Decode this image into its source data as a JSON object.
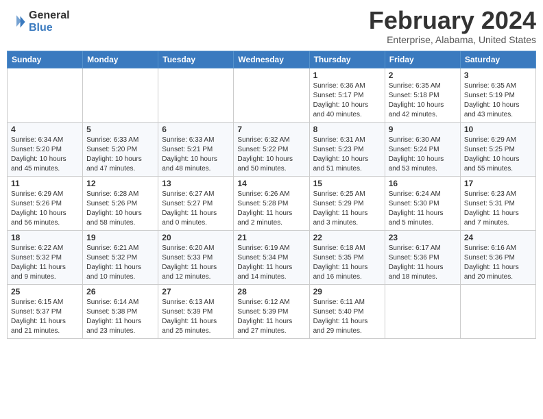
{
  "header": {
    "logo_general": "General",
    "logo_blue": "Blue",
    "month": "February 2024",
    "location": "Enterprise, Alabama, United States"
  },
  "weekdays": [
    "Sunday",
    "Monday",
    "Tuesday",
    "Wednesday",
    "Thursday",
    "Friday",
    "Saturday"
  ],
  "weeks": [
    [
      {
        "day": "",
        "info": ""
      },
      {
        "day": "",
        "info": ""
      },
      {
        "day": "",
        "info": ""
      },
      {
        "day": "",
        "info": ""
      },
      {
        "day": "1",
        "info": "Sunrise: 6:36 AM\nSunset: 5:17 PM\nDaylight: 10 hours\nand 40 minutes."
      },
      {
        "day": "2",
        "info": "Sunrise: 6:35 AM\nSunset: 5:18 PM\nDaylight: 10 hours\nand 42 minutes."
      },
      {
        "day": "3",
        "info": "Sunrise: 6:35 AM\nSunset: 5:19 PM\nDaylight: 10 hours\nand 43 minutes."
      }
    ],
    [
      {
        "day": "4",
        "info": "Sunrise: 6:34 AM\nSunset: 5:20 PM\nDaylight: 10 hours\nand 45 minutes."
      },
      {
        "day": "5",
        "info": "Sunrise: 6:33 AM\nSunset: 5:20 PM\nDaylight: 10 hours\nand 47 minutes."
      },
      {
        "day": "6",
        "info": "Sunrise: 6:33 AM\nSunset: 5:21 PM\nDaylight: 10 hours\nand 48 minutes."
      },
      {
        "day": "7",
        "info": "Sunrise: 6:32 AM\nSunset: 5:22 PM\nDaylight: 10 hours\nand 50 minutes."
      },
      {
        "day": "8",
        "info": "Sunrise: 6:31 AM\nSunset: 5:23 PM\nDaylight: 10 hours\nand 51 minutes."
      },
      {
        "day": "9",
        "info": "Sunrise: 6:30 AM\nSunset: 5:24 PM\nDaylight: 10 hours\nand 53 minutes."
      },
      {
        "day": "10",
        "info": "Sunrise: 6:29 AM\nSunset: 5:25 PM\nDaylight: 10 hours\nand 55 minutes."
      }
    ],
    [
      {
        "day": "11",
        "info": "Sunrise: 6:29 AM\nSunset: 5:26 PM\nDaylight: 10 hours\nand 56 minutes."
      },
      {
        "day": "12",
        "info": "Sunrise: 6:28 AM\nSunset: 5:26 PM\nDaylight: 10 hours\nand 58 minutes."
      },
      {
        "day": "13",
        "info": "Sunrise: 6:27 AM\nSunset: 5:27 PM\nDaylight: 11 hours\nand 0 minutes."
      },
      {
        "day": "14",
        "info": "Sunrise: 6:26 AM\nSunset: 5:28 PM\nDaylight: 11 hours\nand 2 minutes."
      },
      {
        "day": "15",
        "info": "Sunrise: 6:25 AM\nSunset: 5:29 PM\nDaylight: 11 hours\nand 3 minutes."
      },
      {
        "day": "16",
        "info": "Sunrise: 6:24 AM\nSunset: 5:30 PM\nDaylight: 11 hours\nand 5 minutes."
      },
      {
        "day": "17",
        "info": "Sunrise: 6:23 AM\nSunset: 5:31 PM\nDaylight: 11 hours\nand 7 minutes."
      }
    ],
    [
      {
        "day": "18",
        "info": "Sunrise: 6:22 AM\nSunset: 5:32 PM\nDaylight: 11 hours\nand 9 minutes."
      },
      {
        "day": "19",
        "info": "Sunrise: 6:21 AM\nSunset: 5:32 PM\nDaylight: 11 hours\nand 10 minutes."
      },
      {
        "day": "20",
        "info": "Sunrise: 6:20 AM\nSunset: 5:33 PM\nDaylight: 11 hours\nand 12 minutes."
      },
      {
        "day": "21",
        "info": "Sunrise: 6:19 AM\nSunset: 5:34 PM\nDaylight: 11 hours\nand 14 minutes."
      },
      {
        "day": "22",
        "info": "Sunrise: 6:18 AM\nSunset: 5:35 PM\nDaylight: 11 hours\nand 16 minutes."
      },
      {
        "day": "23",
        "info": "Sunrise: 6:17 AM\nSunset: 5:36 PM\nDaylight: 11 hours\nand 18 minutes."
      },
      {
        "day": "24",
        "info": "Sunrise: 6:16 AM\nSunset: 5:36 PM\nDaylight: 11 hours\nand 20 minutes."
      }
    ],
    [
      {
        "day": "25",
        "info": "Sunrise: 6:15 AM\nSunset: 5:37 PM\nDaylight: 11 hours\nand 21 minutes."
      },
      {
        "day": "26",
        "info": "Sunrise: 6:14 AM\nSunset: 5:38 PM\nDaylight: 11 hours\nand 23 minutes."
      },
      {
        "day": "27",
        "info": "Sunrise: 6:13 AM\nSunset: 5:39 PM\nDaylight: 11 hours\nand 25 minutes."
      },
      {
        "day": "28",
        "info": "Sunrise: 6:12 AM\nSunset: 5:39 PM\nDaylight: 11 hours\nand 27 minutes."
      },
      {
        "day": "29",
        "info": "Sunrise: 6:11 AM\nSunset: 5:40 PM\nDaylight: 11 hours\nand 29 minutes."
      },
      {
        "day": "",
        "info": ""
      },
      {
        "day": "",
        "info": ""
      }
    ]
  ]
}
